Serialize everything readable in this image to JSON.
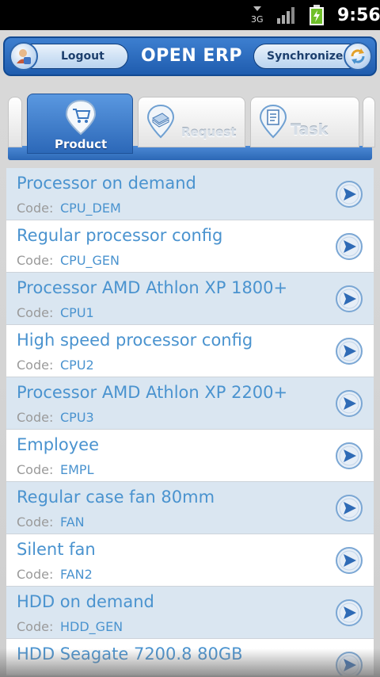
{
  "status_bar": {
    "network": "3G",
    "time": "9:56",
    "icons": [
      "network-3g-icon",
      "signal-icon",
      "battery-charging-icon"
    ]
  },
  "header": {
    "title": "OPEN ERP",
    "logout_label": "Logout",
    "sync_label": "Synchronize"
  },
  "tabs": [
    {
      "label": "Product",
      "icon": "cart-icon",
      "active": true
    },
    {
      "label": "Request",
      "icon": "request-icon",
      "active": false
    },
    {
      "label": "Task",
      "icon": "task-icon",
      "active": false
    }
  ],
  "code_label": "Code:",
  "products": [
    {
      "name": "Processor on demand",
      "code": "CPU_DEM"
    },
    {
      "name": "Regular processor config",
      "code": "CPU_GEN"
    },
    {
      "name": "Processor AMD Athlon XP 1800+",
      "code": "CPU1"
    },
    {
      "name": "High speed processor config",
      "code": "CPU2"
    },
    {
      "name": "Processor AMD Athlon XP 2200+",
      "code": "CPU3"
    },
    {
      "name": "Employee",
      "code": "EMPL"
    },
    {
      "name": "Regular case fan 80mm",
      "code": "FAN"
    },
    {
      "name": "Silent fan",
      "code": "FAN2"
    },
    {
      "name": "HDD on demand",
      "code": "HDD_GEN"
    },
    {
      "name": "HDD Seagate 7200.8 80GB",
      "code": ""
    }
  ],
  "colors": {
    "accent": "#2b67b5",
    "link_text": "#4a93cf",
    "row_alt": "#dae6f1"
  }
}
